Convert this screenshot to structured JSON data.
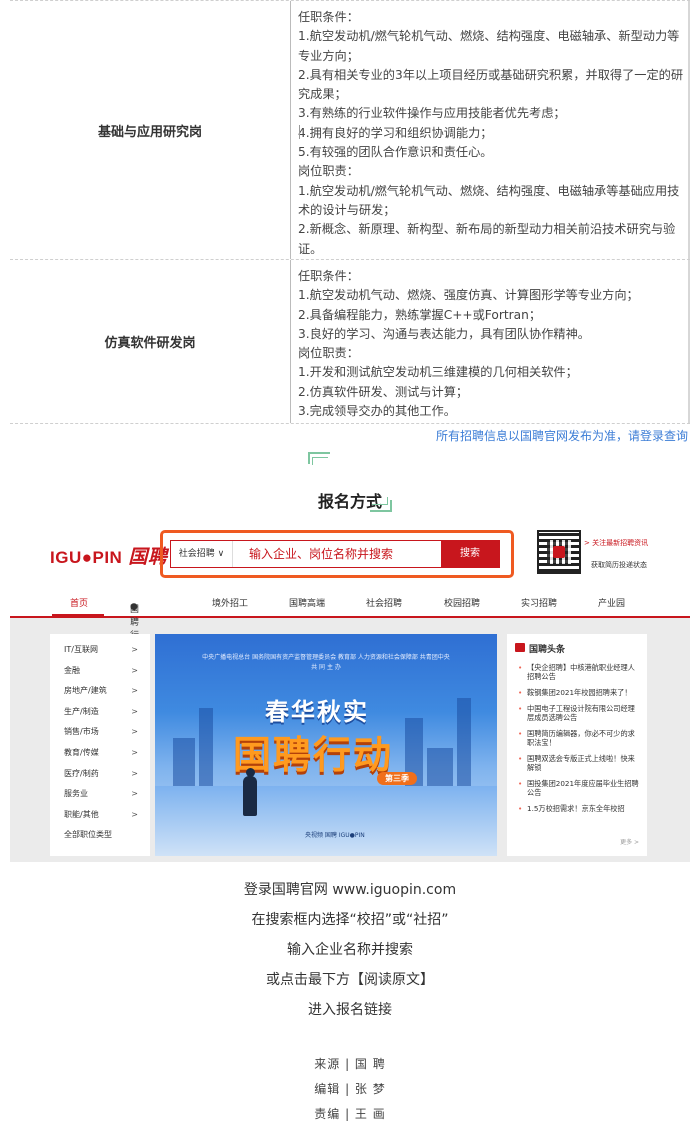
{
  "jobs": [
    {
      "title": "基础与应用研究岗",
      "lines": [
        "任职条件：",
        "1.航空发动机/燃气轮机气动、燃烧、结构强度、电磁轴承、新型动力等专业方向；",
        "2.具有相关专业的3年以上项目经历或基础研究积累，并取得了一定的研究成果；",
        "3.有熟练的行业软件操作与应用技能者优先考虑；",
        "4.拥有良好的学习和组织协调能力；",
        "5.有较强的团队合作意识和责任心。",
        "岗位职责：",
        "1.航空发动机/燃气轮机气动、燃烧、结构强度、电磁轴承等基础应用技术的设计与研发；",
        "2.新概念、新原理、新构型、新布局的新型动力相关前沿技术研究与验证。"
      ]
    },
    {
      "title": "仿真软件研发岗",
      "lines": [
        "任职条件：",
        "1.航空发动机气动、燃烧、强度仿真、计算图形学等专业方向；",
        "2.具备编程能力，熟练掌握C++或Fortran；",
        "3.良好的学习、沟通与表达能力，具有团队协作精神。",
        "岗位职责：",
        "1.开发和测试航空发动机三维建模的几何相关软件；",
        "2.仿真软件研发、测试与计算；",
        "3.完成领导交办的其他工作。"
      ]
    }
  ],
  "notice": "所有招聘信息以国聘官网发布为准，请登录查询",
  "section_heading": "报名方式",
  "site": {
    "logo_en": "IGU●PIN",
    "logo_cn": "国聘",
    "search_category": "社会招聘 ∨",
    "search_placeholder": "输入企业、岗位名称并搜索",
    "search_button": "搜索",
    "qr_text1": "> 关注最新招聘资讯",
    "qr_text2": "获取简历投递状态",
    "nav": [
      "首页",
      "国聘行动",
      "境外招工",
      "国聘高端",
      "社会招聘",
      "校园招聘",
      "实习招聘",
      "产业园"
    ],
    "sidebar": [
      "IT/互联网",
      "金融",
      "房地产/建筑",
      "生产/制造",
      "销售/市场",
      "教育/传媒",
      "医疗/制药",
      "服务业",
      "职能/其他",
      "全部职位类型"
    ],
    "banner_top": "中央广播电视总台  国务院国有资产监督管理委员会  教育部  人力资源和社会保障部  共青团中央",
    "banner_sub": "共 同 主 办",
    "banner_title1": "春华秋实",
    "banner_title2": "国聘行动",
    "banner_tag": "第三季",
    "banner_logos": "央视频      国聘 IGU●PIN",
    "news_title": "国聘头条",
    "news": [
      "【央企招聘】中核港航职业经理人招聘公告",
      "鞍钢集团2021年校园招聘来了！",
      "中国电子工程设计院有限公司经理层成员选聘公告",
      "国聘简历编辑器，你必不可少的求职法宝！",
      "国聘双选会专版正式上线啦！快来解锁",
      "国投集团2021年度应届毕业生招聘公告",
      "1.5万校招需求！京东全年校招"
    ],
    "news_more": "更多 >"
  },
  "instructions": [
    "登录国聘官网 www.iguopin.com",
    "在搜索框内选择“校招”或“社招”",
    "输入企业名称并搜索",
    "或点击最下方【阅读原文】",
    "进入报名链接"
  ],
  "credits": [
    "来源 | 国  聘",
    "编辑 | 张  梦",
    "责编 | 王  画"
  ]
}
